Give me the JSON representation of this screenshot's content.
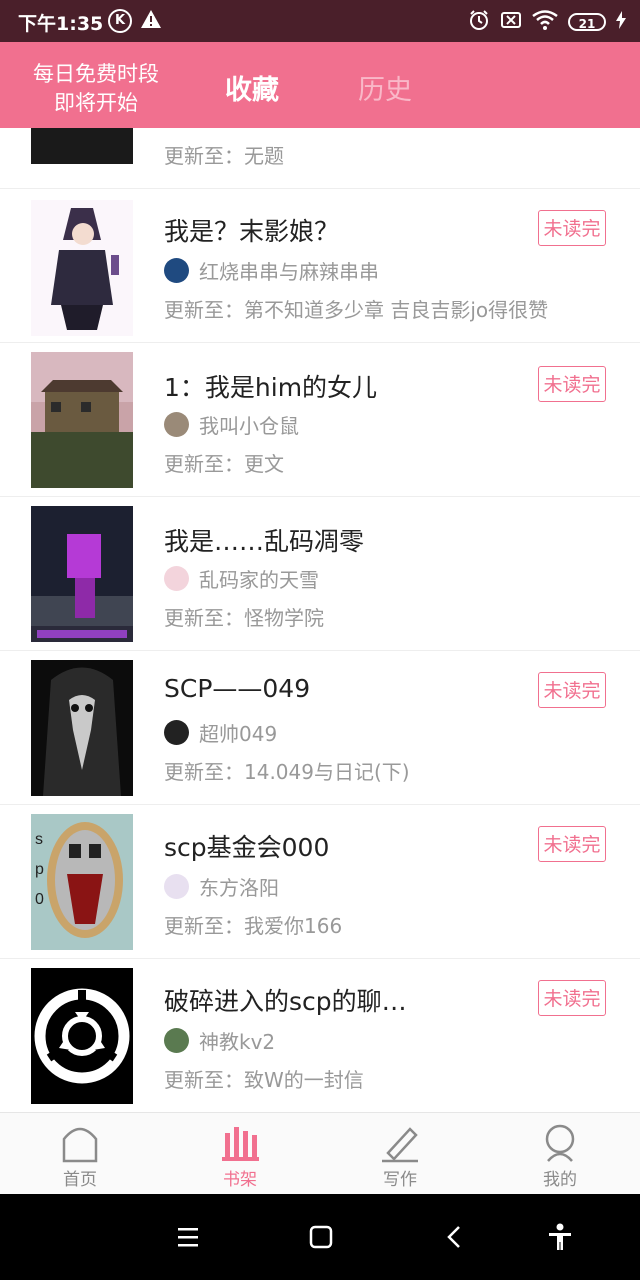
{
  "status_bar": {
    "time": "下午1:35",
    "k_badge": "K",
    "battery": "21"
  },
  "header": {
    "promo_line1": "每日免费时段",
    "promo_line2": "即将开始",
    "tab_favorites": "收藏",
    "tab_history": "历史"
  },
  "labels": {
    "update_prefix": "更新至："
  },
  "items": [
    {
      "title": "",
      "author": "",
      "update": "更新至：无题",
      "badge": ""
    },
    {
      "title": "我是？末影娘？",
      "author": "红烧串串与麻辣串串",
      "update": "更新至：第不知道多少章 吉良吉影jo得很赞",
      "badge": "未读完"
    },
    {
      "title": "1：我是him的女儿",
      "author": "我叫小仓鼠",
      "update": "更新至：更文",
      "badge": "未读完"
    },
    {
      "title": "我是……乱码凋零",
      "author": "乱码家的天雪",
      "update": "更新至：怪物学院",
      "badge": ""
    },
    {
      "title": "SCP——049",
      "author": "超帅049",
      "update": "更新至：14.049与日记(下)",
      "badge": "未读完"
    },
    {
      "title": "scp基金会000",
      "author": "东方洛阳",
      "update": "更新至：我爱你166",
      "badge": "未读完"
    },
    {
      "title": "破碎进入的scp的聊…",
      "author": "神教kv2",
      "update": "更新至：致W的一封信",
      "badge": "未读完"
    }
  ],
  "bottom_nav": {
    "home": "首页",
    "bookshelf": "书架",
    "write": "写作",
    "mine": "我的"
  },
  "colors": {
    "accent": "#f1708f",
    "status_bar": "#4a1f2a",
    "text_gray": "#999999"
  }
}
